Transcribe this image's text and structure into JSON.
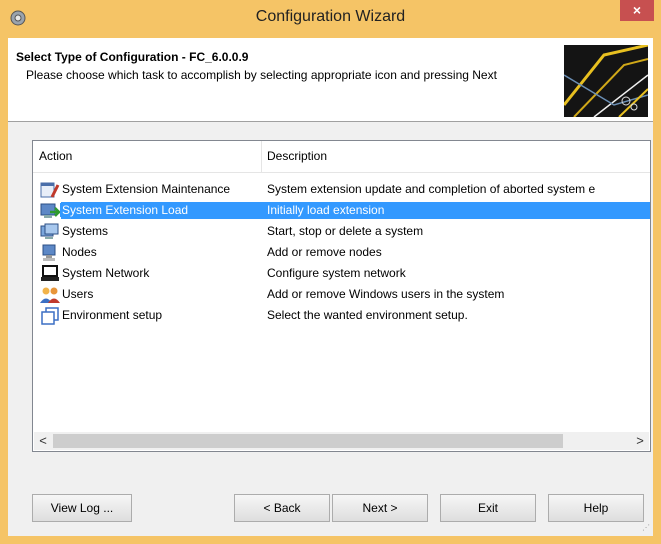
{
  "window": {
    "title": "Configuration Wizard",
    "close_label": "×"
  },
  "header": {
    "title": "Select Type of Configuration - FC_6.0.0.9",
    "description": "Please choose which task to accomplish by selecting appropriate icon and pressing Next"
  },
  "list": {
    "columns": [
      "Action",
      "Description"
    ],
    "rows": [
      {
        "action": "System Extension Maintenance",
        "description": "System extension update and completion of aborted system e",
        "icon": "maintenance-icon",
        "selected": false
      },
      {
        "action": "System Extension Load",
        "description": "Initially load extension",
        "icon": "extension-load-icon",
        "selected": true
      },
      {
        "action": "Systems",
        "description": "Start, stop or delete a system",
        "icon": "systems-icon",
        "selected": false
      },
      {
        "action": "Nodes",
        "description": "Add or remove nodes",
        "icon": "nodes-icon",
        "selected": false
      },
      {
        "action": "System Network",
        "description": "Configure system network",
        "icon": "network-icon",
        "selected": false
      },
      {
        "action": "Users",
        "description": "Add or remove Windows users in the system",
        "icon": "users-icon",
        "selected": false
      },
      {
        "action": "Environment setup",
        "description": "Select the wanted environment setup.",
        "icon": "environment-icon",
        "selected": false
      }
    ],
    "scroll_left": "<",
    "scroll_right": ">"
  },
  "buttons": {
    "view_log": "View Log ...",
    "back": "< Back",
    "next": "Next >",
    "exit": "Exit",
    "help": "Help"
  },
  "colors": {
    "titlebar": "#f5c466",
    "selection": "#3399ff",
    "close": "#c75050"
  }
}
